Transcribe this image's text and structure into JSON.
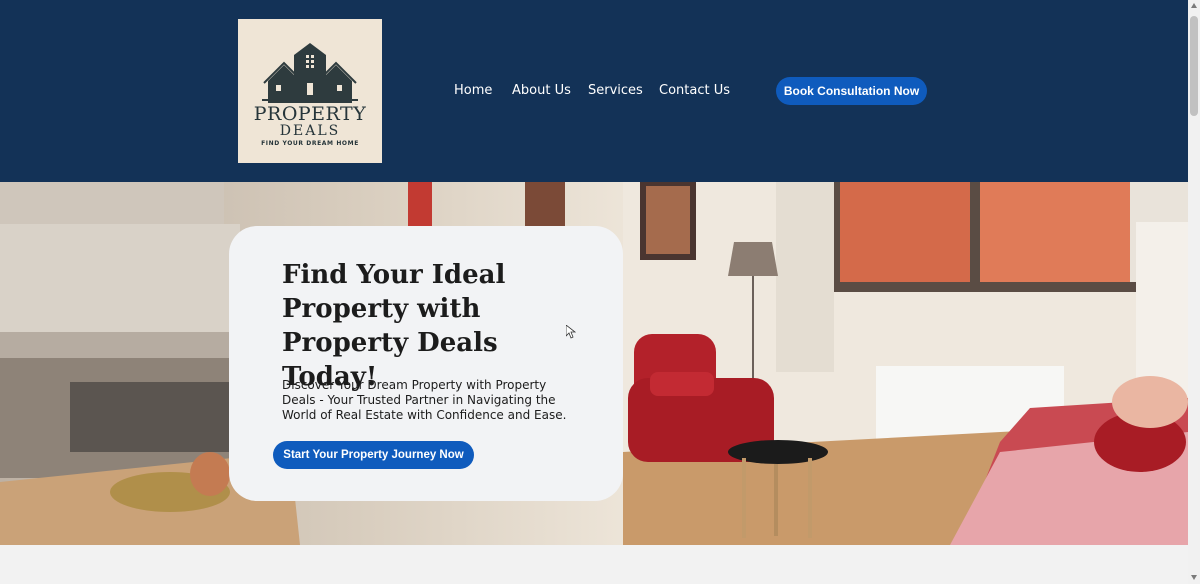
{
  "logo": {
    "title": "PROPERTY",
    "subtitle": "DEALS",
    "tagline": "FIND YOUR DREAM HOME"
  },
  "nav": {
    "items": [
      {
        "label": "Home"
      },
      {
        "label": "About Us"
      },
      {
        "label": "Services"
      },
      {
        "label": "Contact Us"
      }
    ],
    "cta_label": "Book Consultation Now"
  },
  "hero": {
    "title": "Find Your Ideal Property with Property Deals Today!",
    "description": "Discover Your Dream Property with Property Deals - Your Trusted Partner in Navigating the World of Real Estate with Confidence and Ease.",
    "cta_label": "Start Your Property Journey Now"
  },
  "colors": {
    "header_bg": "#133257",
    "button_bg": "#0f5bbd",
    "card_bg": "#f2f3f5",
    "logo_bg": "#efe5d6"
  }
}
